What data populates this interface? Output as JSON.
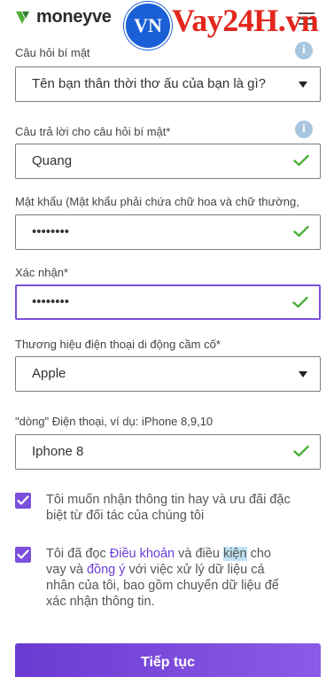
{
  "header": {
    "logo_text": "moneyve",
    "badge_text": "VN",
    "watermark_text": "Vay24H.vn",
    "icons": {
      "logo": "moneyveo-logo-icon",
      "menu": "hamburger-menu-icon"
    }
  },
  "form": {
    "secret_question": {
      "label": "Câu hỏi bí mật",
      "value": "Tên bạn thân thời thơ ấu của bạn là gì?"
    },
    "secret_answer": {
      "label": "Câu trả lời cho câu hỏi bí mật*",
      "value": "Quang"
    },
    "password": {
      "label": "Mật khẩu (Mật khẩu phải chứa chữ hoa và chữ thường,",
      "value": "••••••••"
    },
    "confirm": {
      "label": "Xác nhận*",
      "value": "••••••••"
    },
    "phone_brand": {
      "label": "Thương hiệu điện thoại di động cầm cố*",
      "value": "Apple"
    },
    "phone_model": {
      "label": "\"dòng\" Điện thoại, ví dụ: iPhone 8,9,10",
      "value": "Iphone 8"
    },
    "consent_offers": {
      "text": "Tôi muốn nhận thông tin hay và ưu đãi đặc biệt từ đối tác của chúng tôi",
      "checked": true
    },
    "consent_terms": {
      "prefix": "Tôi đã đọc ",
      "terms_link": "Điều khoản",
      "middle1": " và điều ",
      "highlight": "kiện",
      "middle2": " cho vay và ",
      "agree_link": "đồng ý",
      "suffix": " với việc xử lý dữ liệu cá nhân của tôi, bao gồm chuyển dữ liệu để xác nhận thông tin.",
      "checked": true
    },
    "submit_label": "Tiếp tục"
  },
  "colors": {
    "accent": "#7b4fdc",
    "check": "#4caf3a",
    "info": "#a9c6de",
    "watermark": "#e2261c",
    "badge": "#1b5fd6"
  }
}
